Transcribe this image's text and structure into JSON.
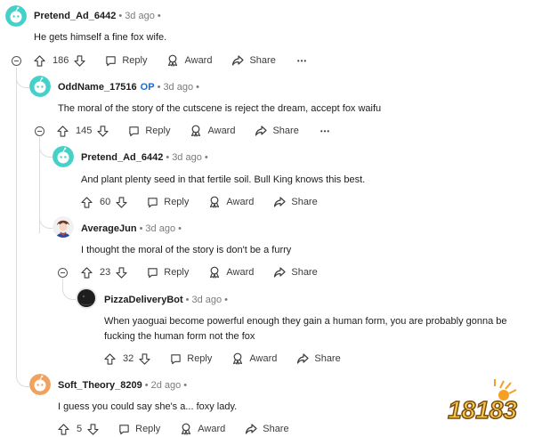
{
  "comments": [
    {
      "author": "Pretend_Ad_6442",
      "op": "",
      "time": "3d ago",
      "dot": "•",
      "text": "He gets himself a fine fox wife.",
      "score": "186",
      "reply": "Reply",
      "award": "Award",
      "share": "Share",
      "more": "•••",
      "avatar_color": "#46d1c8"
    },
    {
      "author": "OddName_17516",
      "op": "OP",
      "time": "3d ago",
      "dot": "•",
      "text": "The moral of the story of the cutscene is reject the dream, accept fox waifu",
      "score": "145",
      "reply": "Reply",
      "award": "Award",
      "share": "Share",
      "more": "•••",
      "avatar_color": "#46d1c8"
    },
    {
      "author": "Pretend_Ad_6442",
      "op": "",
      "time": "3d ago",
      "dot": "•",
      "text": "And plant plenty seed in that fertile soil. Bull King knows this best.",
      "score": "60",
      "reply": "Reply",
      "award": "Award",
      "share": "Share",
      "more": "",
      "avatar_color": "#46d1c8"
    },
    {
      "author": "AverageJun",
      "op": "",
      "time": "3d ago",
      "dot": "•",
      "text": "I thought the moral of the story is don't be a furry",
      "score": "23",
      "reply": "Reply",
      "award": "Award",
      "share": "Share",
      "more": "",
      "avatar_color": "#c94b3a"
    },
    {
      "author": "PizzaDeliveryBot",
      "op": "",
      "time": "3d ago",
      "dot": "•",
      "text": "When yaoguai become powerful enough they gain a human form, you are probably gonna be fucking the human form not the fox",
      "score": "32",
      "reply": "Reply",
      "award": "Award",
      "share": "Share",
      "more": "",
      "avatar_color": "#222222"
    },
    {
      "author": "Soft_Theory_8209",
      "op": "",
      "time": "2d ago",
      "dot": "•",
      "text": "I guess you could say she's a... foxy lady.",
      "score": "5",
      "reply": "Reply",
      "award": "Award",
      "share": "Share",
      "more": "",
      "avatar_color": "#f0a35e"
    }
  ],
  "icons": {
    "upvote": "upvote-icon",
    "downvote": "downvote-icon",
    "reply": "reply-icon",
    "award": "award-icon",
    "share": "share-icon",
    "more": "more-icon",
    "collapse": "collapse-icon"
  },
  "watermark": {
    "text": "18183"
  }
}
